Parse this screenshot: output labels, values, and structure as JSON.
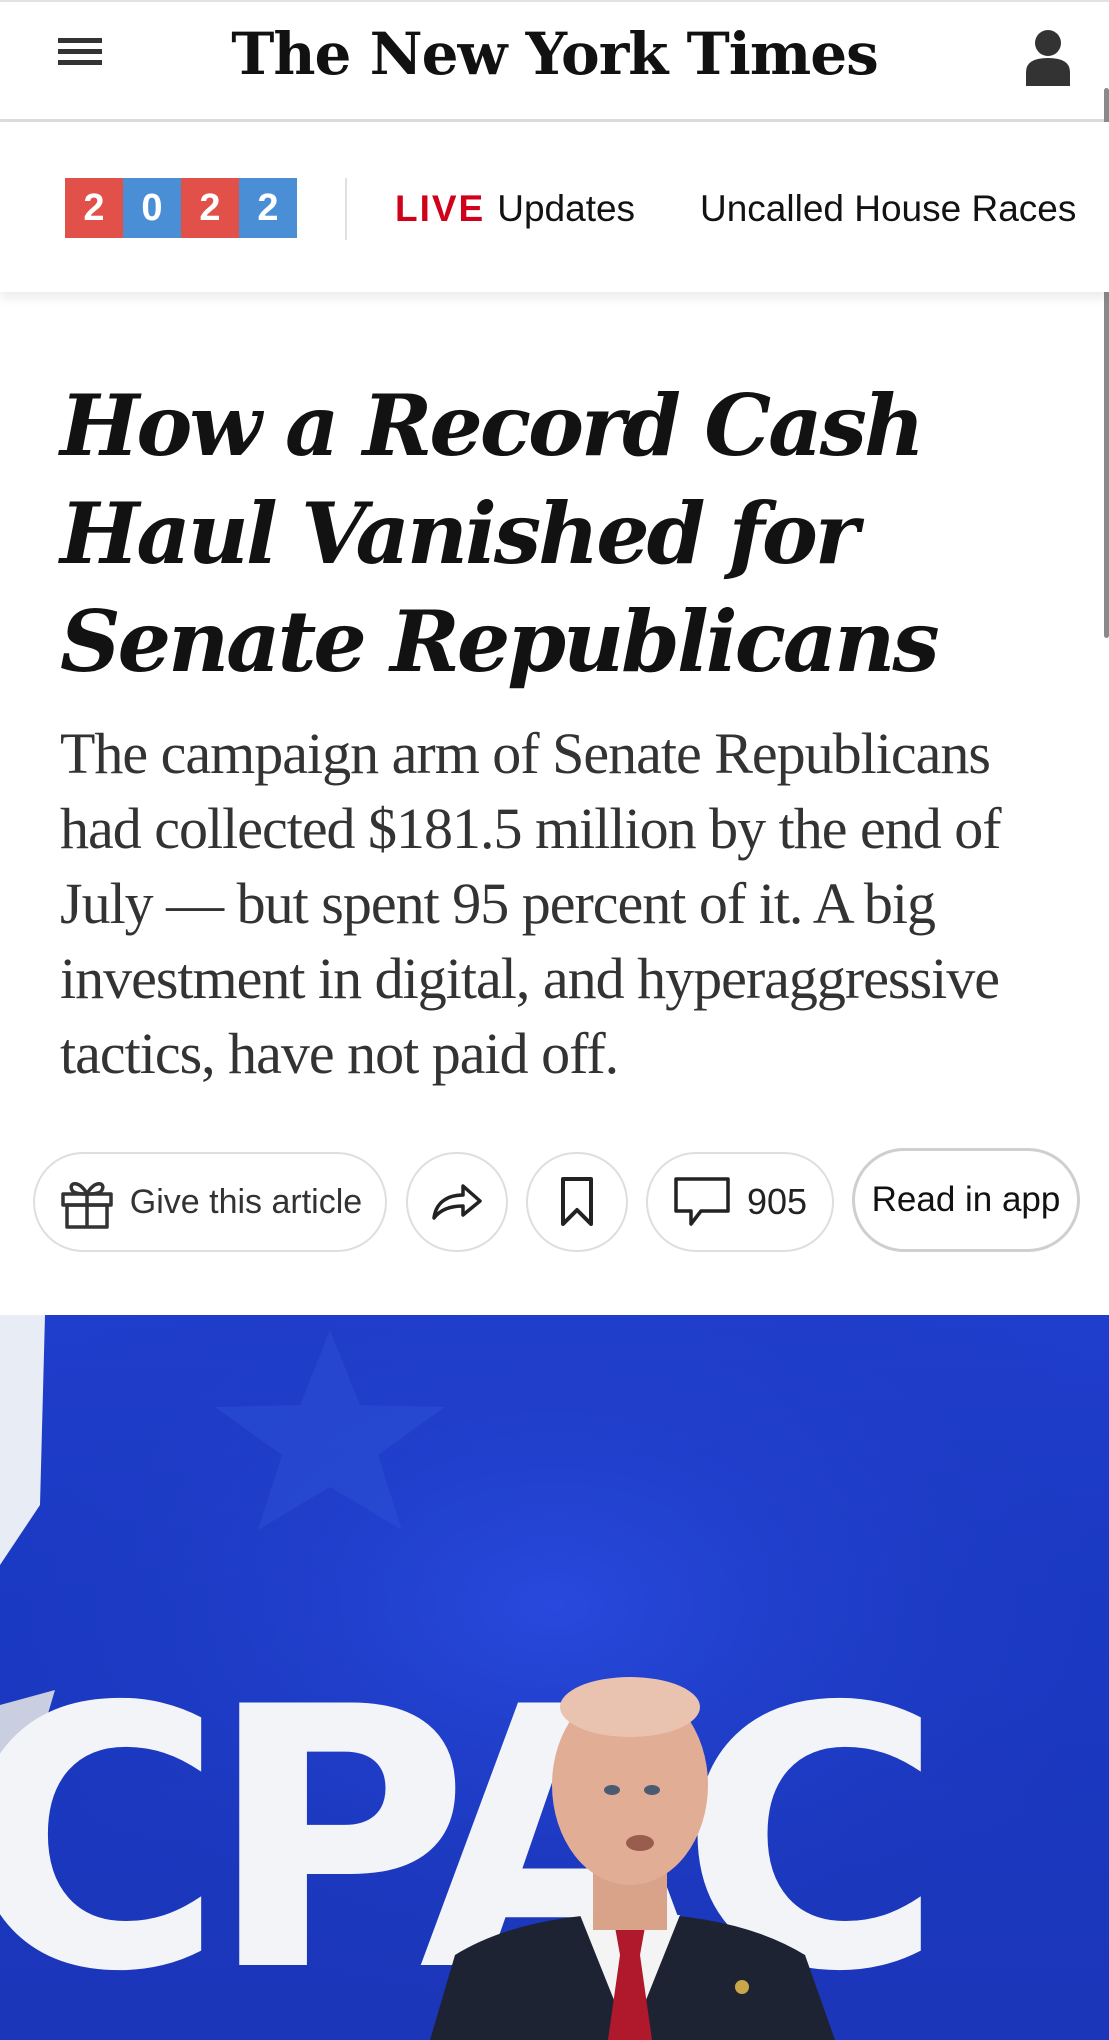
{
  "header": {
    "masthead": "The New York Times",
    "menu_icon": "hamburger-menu-icon",
    "account_icon": "account-person-icon"
  },
  "subnav": {
    "year_digits": [
      "2",
      "0",
      "2",
      "2"
    ],
    "year_colors": [
      "#e2504a",
      "#4a8fd6",
      "#e2504a",
      "#4a8fd6"
    ],
    "live_label": "LIVE",
    "live_link": "Updates",
    "races_link": "Uncalled House Races"
  },
  "article": {
    "headline": "How a Record Cash Haul Vanished for Senate Republicans",
    "summary": "The campaign arm of Senate Republicans had collected $181.5 million by the end of July — but spent 95 percent of it. A big investment in digital, and hyperaggressive tactics, have not paid off."
  },
  "actions": {
    "gift_label": "Give this article",
    "gift_icon": "gift-icon",
    "share_icon": "share-arrow-icon",
    "save_icon": "bookmark-icon",
    "comments_icon": "comment-bubble-icon",
    "comment_count": "905",
    "read_in_app": "Read in app"
  },
  "photo": {
    "sign_text": "CPAC"
  },
  "colors": {
    "live_red": "#d0021b",
    "photo_blue": "#1f3ecc"
  }
}
